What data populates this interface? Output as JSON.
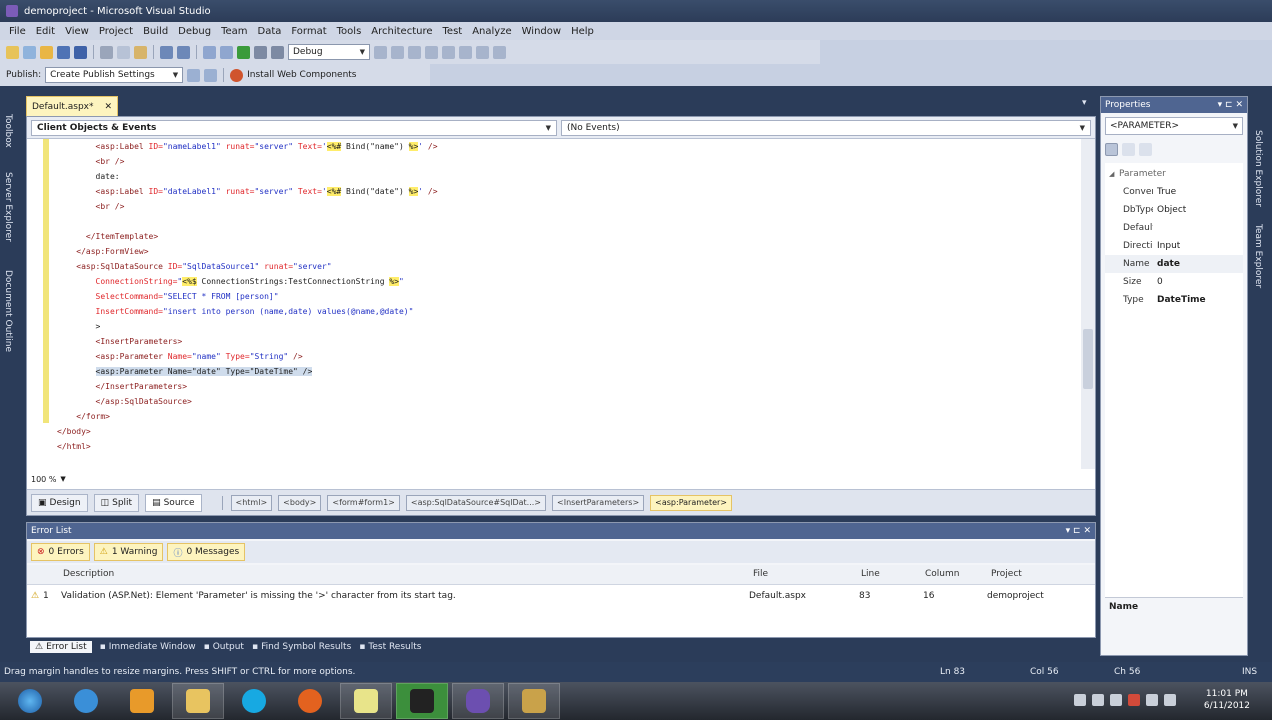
{
  "window": {
    "title": "demoproject - Microsoft Visual Studio"
  },
  "menu": [
    "File",
    "Edit",
    "View",
    "Project",
    "Build",
    "Debug",
    "Team",
    "Data",
    "Format",
    "Tools",
    "Architecture",
    "Test",
    "Analyze",
    "Window",
    "Help"
  ],
  "toolbar": {
    "config": "Debug",
    "publish_label": "Publish:",
    "publish_combo": "Create Publish Settings",
    "web_components": "Install Web Components"
  },
  "doc_tab": {
    "label": "Default.aspx*"
  },
  "nav": {
    "left": "Client Objects & Events",
    "right": "(No Events)"
  },
  "editor": {
    "zoom": "100 %",
    "lines": [
      [
        [
          "        ",
          "k"
        ],
        [
          "<asp:Label",
          "t"
        ],
        [
          " ID=",
          "a"
        ],
        [
          "\"nameLabel1\"",
          "v"
        ],
        [
          " runat=",
          "a"
        ],
        [
          "\"server\"",
          "v"
        ],
        [
          " Text=",
          "a"
        ],
        [
          "'",
          "v"
        ],
        [
          "<%#",
          "hl"
        ],
        [
          " Bind(\"name\") ",
          "k"
        ],
        [
          "%>",
          "hl"
        ],
        [
          "'",
          "v"
        ],
        [
          " />",
          "t"
        ]
      ],
      [
        [
          "        ",
          "k"
        ],
        [
          "<br",
          "t"
        ],
        [
          " />",
          "t"
        ]
      ],
      [
        [
          "        date:",
          "k"
        ]
      ],
      [
        [
          "        ",
          "k"
        ],
        [
          "<asp:Label",
          "t"
        ],
        [
          " ID=",
          "a"
        ],
        [
          "\"dateLabel1\"",
          "v"
        ],
        [
          " runat=",
          "a"
        ],
        [
          "\"server\"",
          "v"
        ],
        [
          " Text=",
          "a"
        ],
        [
          "'",
          "v"
        ],
        [
          "<%#",
          "hl"
        ],
        [
          " Bind(\"date\") ",
          "k"
        ],
        [
          "%>",
          "hl"
        ],
        [
          "'",
          "v"
        ],
        [
          " />",
          "t"
        ]
      ],
      [
        [
          "        ",
          "k"
        ],
        [
          "<br",
          "t"
        ],
        [
          " />",
          "t"
        ]
      ],
      [
        [
          "",
          "k"
        ]
      ],
      [
        [
          "      ",
          "k"
        ],
        [
          "</ItemTemplate>",
          "t"
        ]
      ],
      [
        [
          "    ",
          "k"
        ],
        [
          "</asp:FormView>",
          "t"
        ]
      ],
      [
        [
          "    ",
          "k"
        ],
        [
          "<asp:SqlDataSource",
          "t"
        ],
        [
          " ID=",
          "a"
        ],
        [
          "\"SqlDataSource1\"",
          "v"
        ],
        [
          " runat=",
          "a"
        ],
        [
          "\"server\"",
          "v"
        ]
      ],
      [
        [
          "        ",
          "k"
        ],
        [
          "ConnectionString=",
          "a"
        ],
        [
          "\"",
          "v"
        ],
        [
          "<%$",
          "hl"
        ],
        [
          " ConnectionStrings:TestConnectionString ",
          "k"
        ],
        [
          "%>",
          "hl"
        ],
        [
          "\"",
          "v"
        ]
      ],
      [
        [
          "        ",
          "k"
        ],
        [
          "SelectCommand=",
          "a"
        ],
        [
          "\"SELECT * FROM [person]\"",
          "v"
        ]
      ],
      [
        [
          "        ",
          "k"
        ],
        [
          "InsertCommand=",
          "a"
        ],
        [
          "\"insert into person (name,date) values(@name,@date)\"",
          "v"
        ]
      ],
      [
        [
          "        >",
          "k"
        ]
      ],
      [
        [
          "        ",
          "k"
        ],
        [
          "<InsertParameters>",
          "t"
        ]
      ],
      [
        [
          "        ",
          "k"
        ],
        [
          "<asp:Parameter",
          "t"
        ],
        [
          " Name=",
          "a"
        ],
        [
          "\"name\"",
          "v"
        ],
        [
          " Type=",
          "a"
        ],
        [
          "\"String\"",
          "v"
        ],
        [
          " />",
          "t"
        ]
      ],
      [
        [
          "        ",
          "k"
        ],
        [
          "<asp:Parameter Name=\"date\" Type=\"DateTime\" />",
          "sel"
        ]
      ],
      [
        [
          "        ",
          "k"
        ],
        [
          "</InsertParameters>",
          "t"
        ]
      ],
      [
        [
          "        ",
          "k"
        ],
        [
          "</asp:SqlDataSource>",
          "t"
        ]
      ],
      [
        [
          "    ",
          "k"
        ],
        [
          "</form>",
          "t"
        ]
      ],
      [
        [
          "",
          "k"
        ],
        [
          "</body>",
          "t"
        ]
      ],
      [
        [
          "",
          "k"
        ],
        [
          "</html>",
          "t"
        ]
      ]
    ]
  },
  "view": {
    "design": "Design",
    "split": "Split",
    "source": "Source"
  },
  "breadcrumbs": [
    "<html>",
    "<body>",
    "<form#form1>",
    "<asp:SqlDataSource#SqlDat...>",
    "<InsertParameters>",
    "<asp:Parameter>"
  ],
  "properties": {
    "title": "Properties",
    "object": "<PARAMETER>",
    "category": "Parameter",
    "rows": [
      {
        "name": "ConvertE",
        "value": "True"
      },
      {
        "name": "DbType",
        "value": "Object"
      },
      {
        "name": "DefaultV",
        "value": ""
      },
      {
        "name": "Direction",
        "value": "Input"
      },
      {
        "name": "Name",
        "value": "date"
      },
      {
        "name": "Size",
        "value": "0"
      },
      {
        "name": "Type",
        "value": "DateTime"
      }
    ],
    "desc_title": "Name"
  },
  "errors": {
    "title": "Error List",
    "filters": {
      "errors": "0 Errors",
      "warnings": "1 Warning",
      "messages": "0 Messages"
    },
    "columns": {
      "description": "Description",
      "file": "File",
      "line": "Line",
      "column": "Column",
      "project": "Project"
    },
    "rows": [
      {
        "index": "1",
        "description": "Validation (ASP.Net): Element 'Parameter' is missing the '>' character from its start tag.",
        "file": "Default.aspx",
        "line": "83",
        "column": "16",
        "project": "demoproject"
      }
    ]
  },
  "bottom_tabs": [
    "Error List",
    "Immediate Window",
    "Output",
    "Find Symbol Results",
    "Test Results"
  ],
  "left_tabs": [
    "Toolbox",
    "Server Explorer",
    "Document Outline"
  ],
  "right_tabs": [
    "Solution Explorer",
    "Team Explorer"
  ],
  "status": {
    "message": "Drag margin handles to resize margins. Press SHIFT or CTRL for more options.",
    "ln": "Ln 83",
    "col": "Col 56",
    "ch": "Ch 56",
    "mode": "INS"
  },
  "taskbar": {
    "time": "11:01 PM",
    "date": "6/11/2012"
  },
  "colors": {
    "accent": "#fdf4bf",
    "chrome": "#2b3c59",
    "tag": "#8b1d1d",
    "attr": "#e0282c",
    "value": "#2231c4"
  }
}
